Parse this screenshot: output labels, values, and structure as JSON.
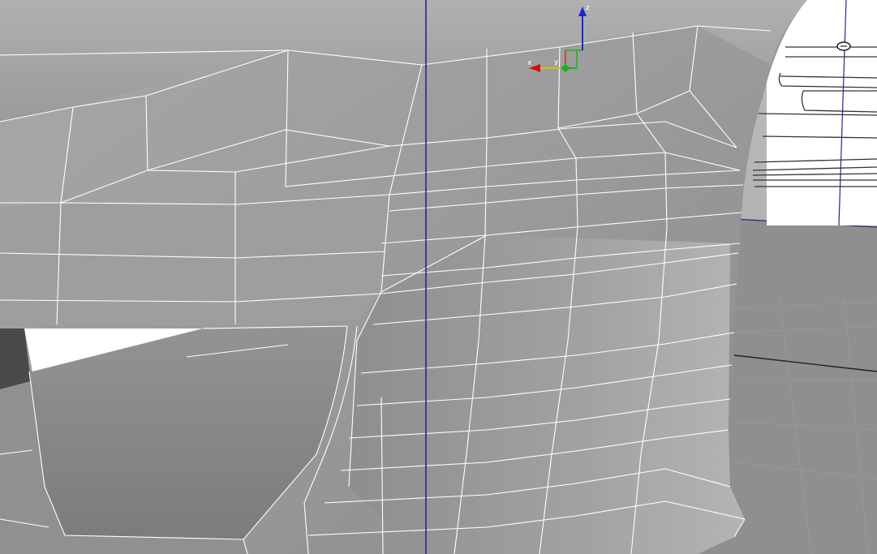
{
  "viewport": {
    "name": "3d-perspective-viewport",
    "background_color": "#a9a9a9",
    "ground_color": "#8f8f8f",
    "surface_color": "#9b9b9b",
    "wire_color": "#ffffff",
    "axis_line_color": "#1e2a8c"
  },
  "gizmo": {
    "x_label": "x",
    "y_label": "y",
    "z_label": "z",
    "x_color": "#d01010",
    "y_color": "#20b020",
    "z_color": "#1a2ad0"
  },
  "background_part": {
    "badge_icon": "emblem-icon"
  }
}
